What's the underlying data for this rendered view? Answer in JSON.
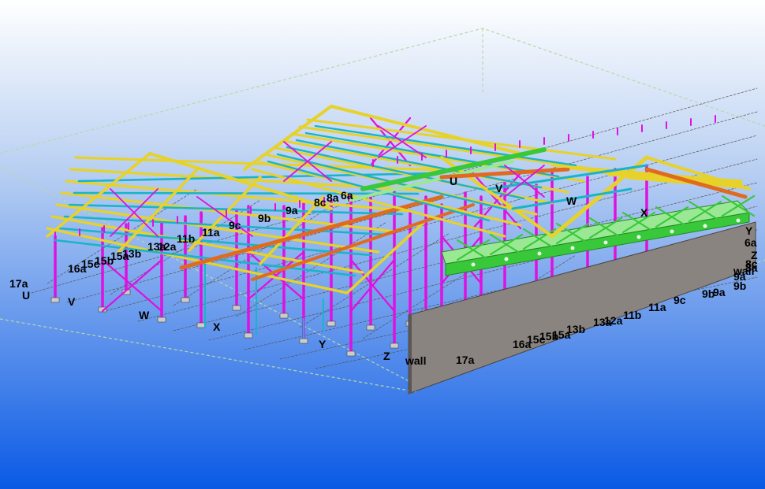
{
  "viewport": {
    "background_top": "#ffffff",
    "background_bottom": "#0a5ae6"
  },
  "colors": {
    "column": "#e010e0",
    "beam_yellow": "#e6d22a",
    "beam_cyan": "#1ab4c8",
    "beam_orange": "#e06a1e",
    "beam_green": "#38c83a",
    "wall": "#8a8480",
    "grid_line": "#555555",
    "bounding_box": "#b8d8a8"
  },
  "grid_labels_left": [
    "17a",
    "16a",
    "15c",
    "15b",
    "15a",
    "13b",
    "13a",
    "12a",
    "11b",
    "11a",
    "9c",
    "9b",
    "9a",
    "8c",
    "8a",
    "6a"
  ],
  "grid_labels_ltr": [
    "U",
    "V",
    "W",
    "X",
    "Y",
    "Z"
  ],
  "wall_label": "wall",
  "wall_grid_labels": [
    "17a",
    "16a",
    "15c",
    "15b",
    "15a",
    "13b",
    "13a",
    "12a",
    "11b",
    "11a",
    "9c",
    "9b",
    "9a"
  ],
  "right_edge_labels": [
    "Y",
    "6a",
    "Z",
    "wall",
    "8c",
    "8a",
    "9a",
    "9b"
  ],
  "roof_labels": [
    "U",
    "V",
    "W",
    "X"
  ]
}
